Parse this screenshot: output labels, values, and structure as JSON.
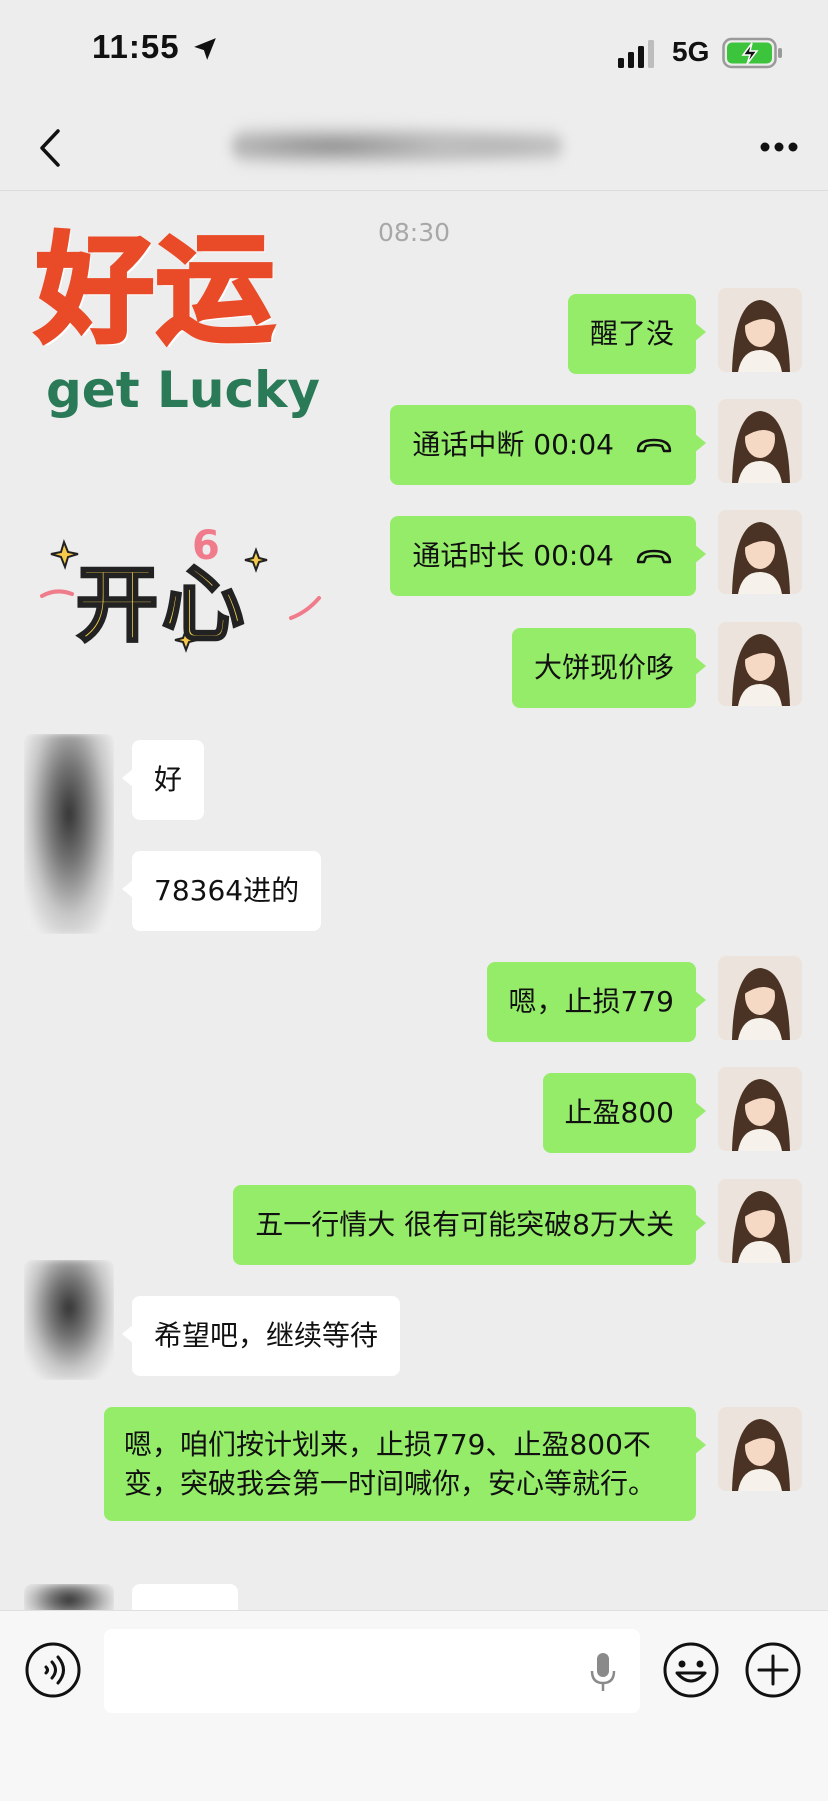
{
  "status_bar": {
    "time": "11:55",
    "network": "5G",
    "icons": [
      "location-arrow-icon",
      "signal-bars-icon",
      "battery-charging-icon"
    ]
  },
  "nav": {
    "back_icon": "chevron-left-icon",
    "more_icon": "ellipsis-icon"
  },
  "chat": {
    "timestamp": "08:30",
    "stickers": [
      {
        "name": "good-luck-sticker",
        "line1": "好运",
        "line2": "get Lucky"
      },
      {
        "name": "happy-sticker",
        "text": "开心",
        "mark": "6"
      }
    ],
    "messages": [
      {
        "sender": "me",
        "text": "醒了没"
      },
      {
        "sender": "me",
        "text": "通话中断 00:04",
        "icon": "hangup-icon"
      },
      {
        "sender": "me",
        "text": "通话时长 00:04",
        "icon": "hangup-icon"
      },
      {
        "sender": "me",
        "text": "大饼现价哆"
      },
      {
        "sender": "other",
        "text": "好"
      },
      {
        "sender": "other",
        "text": "78364进的"
      },
      {
        "sender": "me",
        "text": "嗯，止损779"
      },
      {
        "sender": "me",
        "text": "止盈800"
      },
      {
        "sender": "me",
        "text": "五一行情大 很有可能突破8万大关"
      },
      {
        "sender": "other",
        "text": "希望吧，继续等待"
      },
      {
        "sender": "me",
        "text": "嗯，咱们按计划来，止损779、止盈800不变，突破我会第一时间喊你，安心等就行。"
      }
    ]
  },
  "input_bar": {
    "icons": [
      "voice-icon",
      "microphone-icon",
      "emoji-icon",
      "plus-icon"
    ]
  },
  "colors": {
    "background": "#ededed",
    "my_bubble": "#95ec69",
    "other_bubble": "#ffffff",
    "timestamp": "#a8a8a8"
  }
}
